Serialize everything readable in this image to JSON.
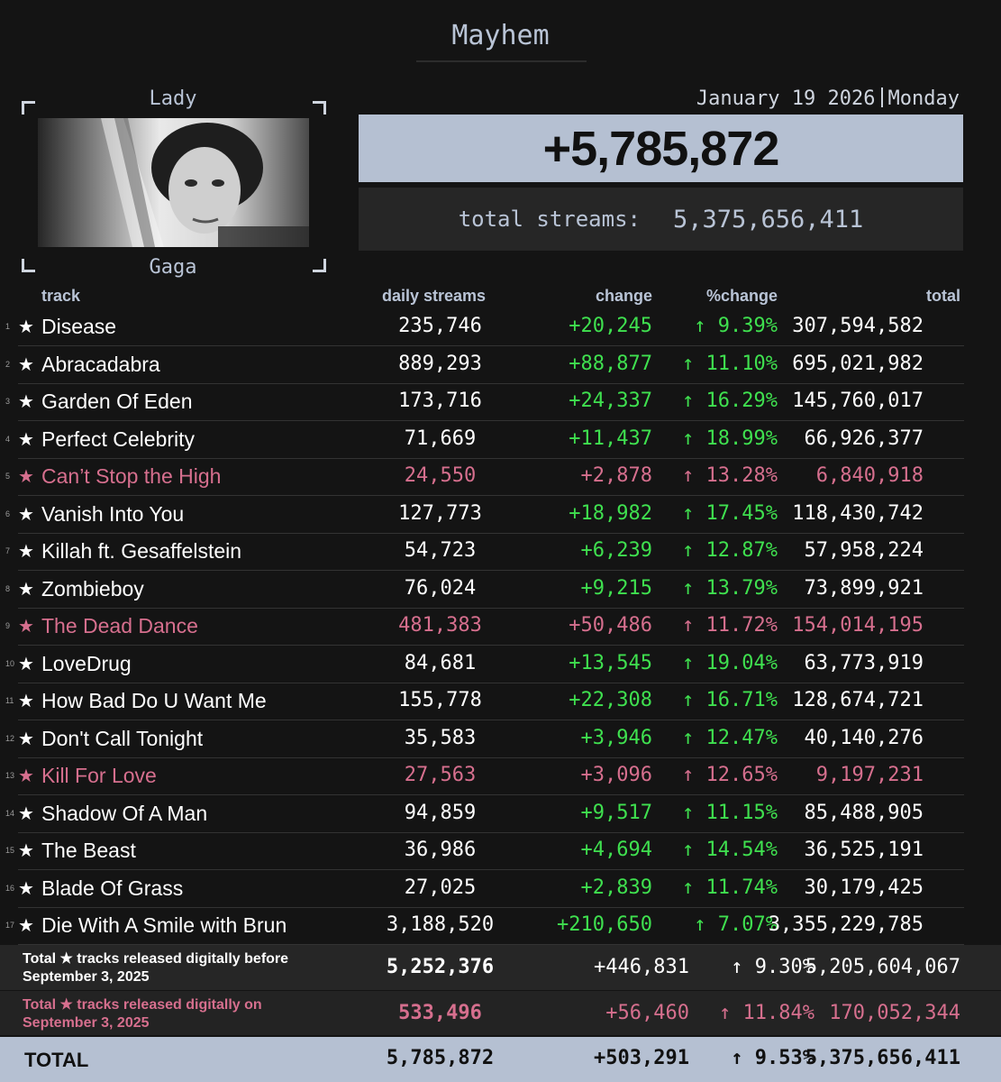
{
  "album_title": "Mayhem",
  "artist": {
    "first": "Lady",
    "last": "Gaga"
  },
  "date": "January 19 2026",
  "weekday": "Monday",
  "daily_total": "+5,785,872",
  "total_streams_label": "total streams:",
  "total_streams_value": "5,375,656,411",
  "columns": {
    "track": "track",
    "daily": "daily streams",
    "change": "change",
    "pct": "%change",
    "total": "total"
  },
  "colors": {
    "accent": "#b5c0d2",
    "positive": "#3fe04f",
    "highlight": "#d66f8e",
    "background": "#141414"
  },
  "tracks": [
    {
      "rank": "1",
      "star": "★",
      "name": "Disease",
      "daily": "235,746",
      "change": "+20,245",
      "pct": "↑ 9.39%",
      "total": "307,594,582",
      "highlight": false
    },
    {
      "rank": "2",
      "star": "★",
      "name": "Abracadabra",
      "daily": "889,293",
      "change": "+88,877",
      "pct": "↑ 11.10%",
      "total": "695,021,982",
      "highlight": false
    },
    {
      "rank": "3",
      "star": "★",
      "name": "Garden Of Eden",
      "daily": "173,716",
      "change": "+24,337",
      "pct": "↑ 16.29%",
      "total": "145,760,017",
      "highlight": false
    },
    {
      "rank": "4",
      "star": "★",
      "name": "Perfect Celebrity",
      "daily": "71,669",
      "change": "+11,437",
      "pct": "↑ 18.99%",
      "total": "66,926,377",
      "highlight": false
    },
    {
      "rank": "5",
      "star": "★",
      "name": "Can’t Stop the High",
      "daily": "24,550",
      "change": "+2,878",
      "pct": "↑ 13.28%",
      "total": "6,840,918",
      "highlight": true
    },
    {
      "rank": "6",
      "star": "★",
      "name": "Vanish Into You",
      "daily": "127,773",
      "change": "+18,982",
      "pct": "↑ 17.45%",
      "total": "118,430,742",
      "highlight": false
    },
    {
      "rank": "7",
      "star": "★",
      "name": "Killah ft. Gesaffelstein",
      "daily": "54,723",
      "change": "+6,239",
      "pct": "↑ 12.87%",
      "total": "57,958,224",
      "highlight": false
    },
    {
      "rank": "8",
      "star": "★",
      "name": "Zombieboy",
      "daily": "76,024",
      "change": "+9,215",
      "pct": "↑ 13.79%",
      "total": "73,899,921",
      "highlight": false
    },
    {
      "rank": "9",
      "star": "★",
      "name": "The Dead Dance",
      "daily": "481,383",
      "change": "+50,486",
      "pct": "↑ 11.72%",
      "total": "154,014,195",
      "highlight": true
    },
    {
      "rank": "10",
      "star": "★",
      "name": "LoveDrug",
      "daily": "84,681",
      "change": "+13,545",
      "pct": "↑ 19.04%",
      "total": "63,773,919",
      "highlight": false
    },
    {
      "rank": "11",
      "star": "★",
      "name": "How Bad Do U Want Me",
      "daily": "155,778",
      "change": "+22,308",
      "pct": "↑ 16.71%",
      "total": "128,674,721",
      "highlight": false
    },
    {
      "rank": "12",
      "star": "★",
      "name": "Don't Call Tonight",
      "daily": "35,583",
      "change": "+3,946",
      "pct": "↑ 12.47%",
      "total": "40,140,276",
      "highlight": false
    },
    {
      "rank": "13",
      "star": "★",
      "name": "Kill For Love",
      "daily": "27,563",
      "change": "+3,096",
      "pct": "↑ 12.65%",
      "total": "9,197,231",
      "highlight": true
    },
    {
      "rank": "14",
      "star": "★",
      "name": "Shadow Of A Man",
      "daily": "94,859",
      "change": "+9,517",
      "pct": "↑ 11.15%",
      "total": "85,488,905",
      "highlight": false
    },
    {
      "rank": "15",
      "star": "★",
      "name": "The Beast",
      "daily": "36,986",
      "change": "+4,694",
      "pct": "↑ 14.54%",
      "total": "36,525,191",
      "highlight": false
    },
    {
      "rank": "16",
      "star": "★",
      "name": "Blade Of Grass",
      "daily": "27,025",
      "change": "+2,839",
      "pct": "↑ 11.74%",
      "total": "30,179,425",
      "highlight": false
    },
    {
      "rank": "17",
      "star": "★",
      "name": "Die With A Smile with Brun",
      "daily": "3,188,520",
      "change": "+210,650",
      "pct": "↑ 7.07%",
      "total": "3,355,229,785",
      "highlight": false
    }
  ],
  "summary_before": {
    "label": "Total ★ tracks released digitally before September 3, 2025",
    "daily": "5,252,376",
    "change": "+446,831",
    "pct": "↑ 9.30%",
    "total": "5,205,604,067"
  },
  "summary_on": {
    "label": "Total ★ tracks released digitally on September 3, 2025",
    "daily": "533,496",
    "change": "+56,460",
    "pct": "↑ 11.84%",
    "total": "170,052,344"
  },
  "grand_total": {
    "label": "TOTAL",
    "daily": "5,785,872",
    "change": "+503,291",
    "pct": "↑ 9.53%",
    "total": "5,375,656,411"
  }
}
